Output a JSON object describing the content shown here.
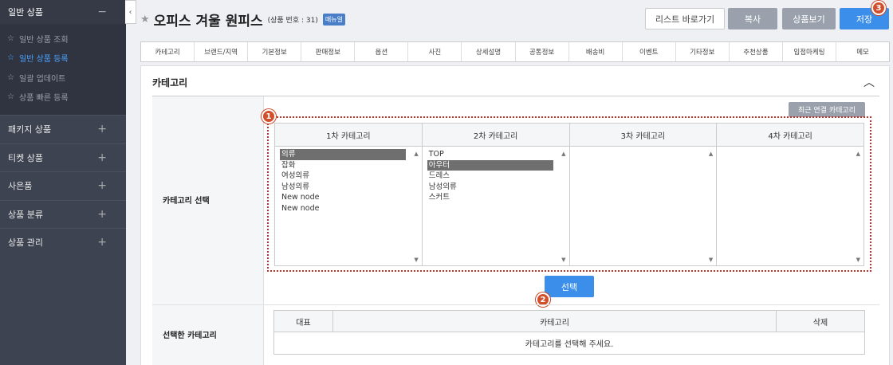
{
  "sidebar": {
    "header": {
      "label": "일반 상품",
      "toggle": "−"
    },
    "sub_items": [
      {
        "label": "일반 상품 조회"
      },
      {
        "label": "일반 상품 등록"
      },
      {
        "label": "일괄 업데이트"
      },
      {
        "label": "상품 빠른 등록"
      }
    ],
    "sections": [
      {
        "label": "패키지 상품",
        "toggle": "+"
      },
      {
        "label": "티켓 상품",
        "toggle": "+"
      },
      {
        "label": "사은품",
        "toggle": "+"
      },
      {
        "label": "상품 분류",
        "toggle": "+"
      },
      {
        "label": "상품 관리",
        "toggle": "+"
      }
    ],
    "collapse_glyph": "‹"
  },
  "header": {
    "title": "오피스 겨울 원피스",
    "product_no": "(상품 번호 : 31)",
    "manual_badge": "매뉴얼",
    "buttons": {
      "list": "리스트 바로가기",
      "copy": "복사",
      "view": "상품보기",
      "save": "저장"
    }
  },
  "tabs": [
    "카테고리",
    "브랜드/지역",
    "기본정보",
    "판매정보",
    "옵션",
    "사진",
    "상세설명",
    "공통정보",
    "배송비",
    "이벤트",
    "기타정보",
    "추천상품",
    "입점마케팅",
    "메모"
  ],
  "section": {
    "title": "카테고리",
    "category_select_label": "카테고리 선택",
    "recent_button": "최근 연결 카테고리",
    "columns": [
      {
        "header": "1차 카테고리",
        "items": [
          "의류",
          "잡화",
          "여성의류",
          "남성의류",
          "New node",
          "New node"
        ]
      },
      {
        "header": "2차 카테고리",
        "items": [
          "TOP",
          "아우터",
          "드레스",
          "남성의류",
          "스커트"
        ]
      },
      {
        "header": "3차 카테고리",
        "items": []
      },
      {
        "header": "4차 카테고리",
        "items": []
      }
    ],
    "select_button": "선택",
    "selected_label": "선택한 카테고리",
    "table_headers": {
      "rep": "대표",
      "category": "카테고리",
      "delete": "삭제"
    },
    "empty_message": "카테고리를 선택해 주세요."
  },
  "callouts": [
    "1",
    "2",
    "3"
  ],
  "colors": {
    "accent": "#3b8eea",
    "callout": "#d24f2c",
    "sidebar_bg": "#3d4350"
  }
}
